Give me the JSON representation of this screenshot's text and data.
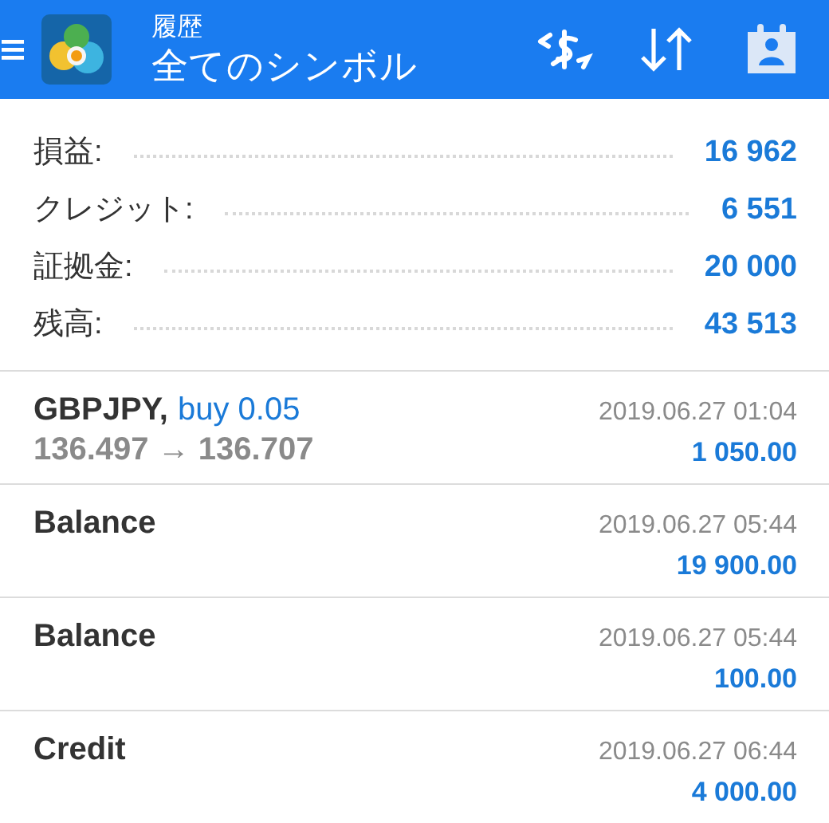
{
  "header": {
    "subtitle": "履歴",
    "title": "全てのシンボル"
  },
  "summary": [
    {
      "label": "損益:",
      "value": "16 962"
    },
    {
      "label": "クレジット:",
      "value": "6 551"
    },
    {
      "label": "証拠金:",
      "value": "20 000"
    },
    {
      "label": "残高:",
      "value": "43 513"
    }
  ],
  "deals": [
    {
      "kind": "trade",
      "symbol": "GBPJPY,",
      "action": "buy 0.05",
      "prices": "136.497 → 136.707",
      "time": "2019.06.27 01:04",
      "amount": "1 050.00"
    },
    {
      "kind": "plain",
      "symbol": "Balance",
      "time": "2019.06.27 05:44",
      "amount": "19 900.00"
    },
    {
      "kind": "plain",
      "symbol": "Balance",
      "time": "2019.06.27 05:44",
      "amount": "100.00"
    },
    {
      "kind": "plain",
      "symbol": "Credit",
      "time": "2019.06.27 06:44",
      "amount": "4 000.00"
    }
  ]
}
